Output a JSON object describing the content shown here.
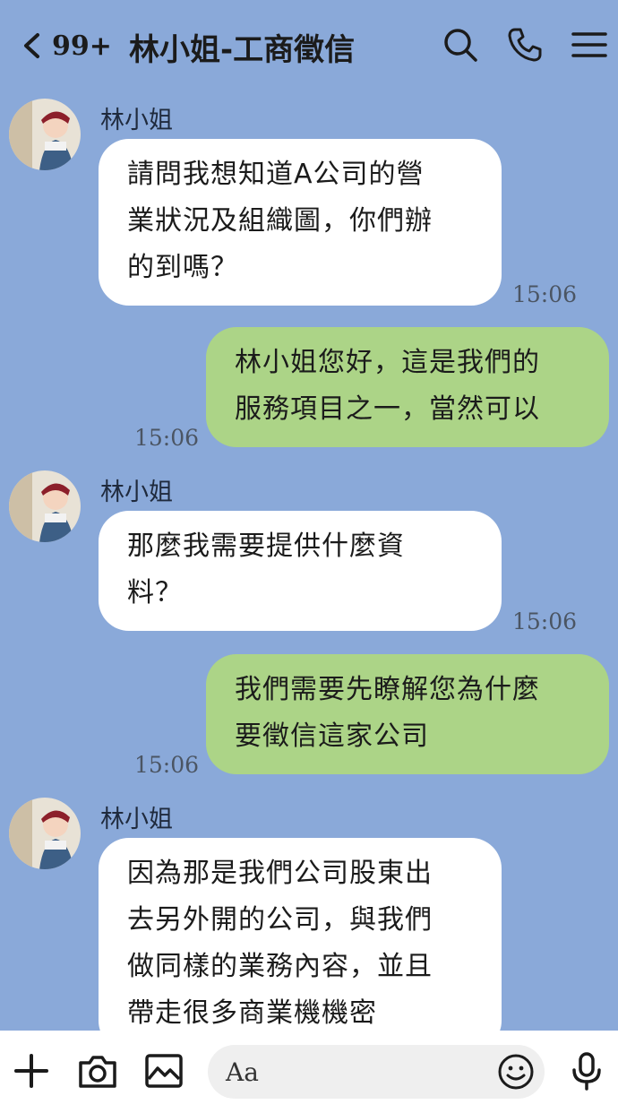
{
  "header": {
    "unread_count": "99+",
    "title": "林小姐-工商徵信",
    "icons": [
      "chevron-left-icon",
      "search-icon",
      "phone-icon",
      "menu-icon"
    ]
  },
  "messages": [
    {
      "direction": "incoming",
      "sender": "林小姐",
      "lines": [
        "請問我想知道A公司的營",
        "業狀況及組織圖，你們辦",
        "的到嗎？"
      ],
      "time": "15:06"
    },
    {
      "direction": "outgoing",
      "lines": [
        "林小姐您好，這是我們的",
        "服務項目之一，當然可以"
      ],
      "time": "15:06"
    },
    {
      "direction": "incoming",
      "sender": "林小姐",
      "lines": [
        "那麼我需要提供什麼資",
        "料？"
      ],
      "time": "15:06"
    },
    {
      "direction": "outgoing",
      "lines": [
        "我們需要先瞭解您為什麼",
        "要徵信這家公司"
      ],
      "time": "15:06"
    },
    {
      "direction": "incoming",
      "sender": "林小姐",
      "lines": [
        "因為那是我們公司股東出",
        "去另外開的公司，與我們",
        "做同樣的業務內容，並且",
        "帶走很多商業機機密"
      ]
    }
  ],
  "composer": {
    "placeholder": "Aa",
    "icons": [
      "plus-icon",
      "camera-icon",
      "image-icon",
      "emoji-icon",
      "microphone-icon"
    ]
  },
  "colors": {
    "background": "#8aa9d9",
    "incoming_bubble": "#ffffff",
    "outgoing_bubble": "#acd487"
  }
}
